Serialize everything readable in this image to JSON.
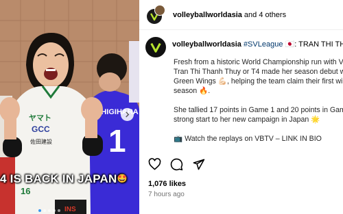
{
  "media": {
    "overlay_text": "4 IS BACK IN JAPAN",
    "overlay_emoji": "🤩",
    "jersey_sponsors": [
      "ヤマト",
      "GCC",
      "佐田建設"
    ],
    "jersey_number": "16",
    "back_jersey_name": "SHIGIHARA",
    "back_jersey_number": "1",
    "shoe_brand": "INS"
  },
  "header": {
    "account": "volleyballworldasia",
    "suffix": " and 4 others"
  },
  "post": {
    "account": "volleyballworldasia",
    "hashtag": "#SVLeague",
    "headline_tail": " 🇯🇵: TRAN THI THANH"
  },
  "caption": {
    "p1_l1": "Fresh from a historic World Championship run with V",
    "p1_l2": "Tran Thi Thanh Thuy or T4 made her season debut wit",
    "p1_l3": "Green Wings 💪🏻, helping the team claim their first wi",
    "p1_l4": "season 🔥.",
    "p2_l1": "She tallied 17 points in Game 1 and 20 points in Gam",
    "p2_l2": "strong start to her new campaign in Japan 🌟",
    "p3_l1": "📺 Watch the replays on VBTV – LINK IN BIO"
  },
  "stats": {
    "likes": "1,076 likes",
    "time": "7 hours ago"
  },
  "colors": {
    "brand_green": "#b8e62e",
    "jersey_blue": "#3a2bd6",
    "link": "#00376b"
  }
}
